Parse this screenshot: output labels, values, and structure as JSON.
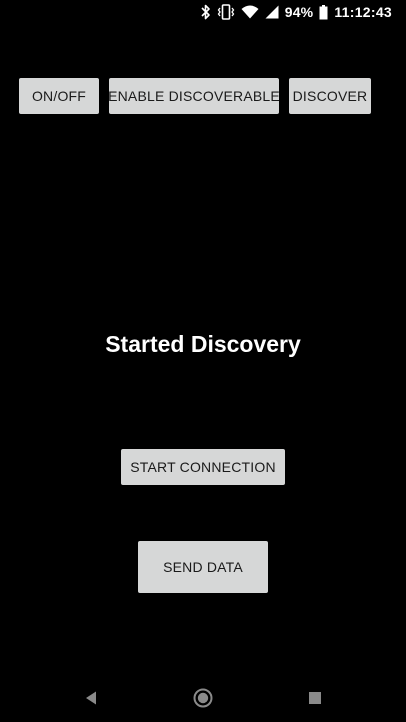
{
  "status_bar": {
    "battery_percent": "94%",
    "time": "11:12:43",
    "icons": [
      "bluetooth-icon",
      "vibrate-icon",
      "wifi-icon",
      "signal-icon",
      "battery-icon"
    ]
  },
  "toolbar": {
    "onoff_label": "ON/OFF",
    "enable_discoverable_label": "ENABLE DISCOVERABLE",
    "discover_label": "DISCOVER"
  },
  "main": {
    "status_message": "Started Discovery",
    "start_connection_label": "START CONNECTION",
    "send_data_label": "SEND DATA"
  },
  "nav_bar": {
    "icons": [
      "back-icon",
      "home-icon",
      "recents-icon"
    ]
  },
  "colors": {
    "background": "#000000",
    "button": "#d6d7d7",
    "button_text": "#1a1a1a",
    "text": "#ffffff"
  }
}
